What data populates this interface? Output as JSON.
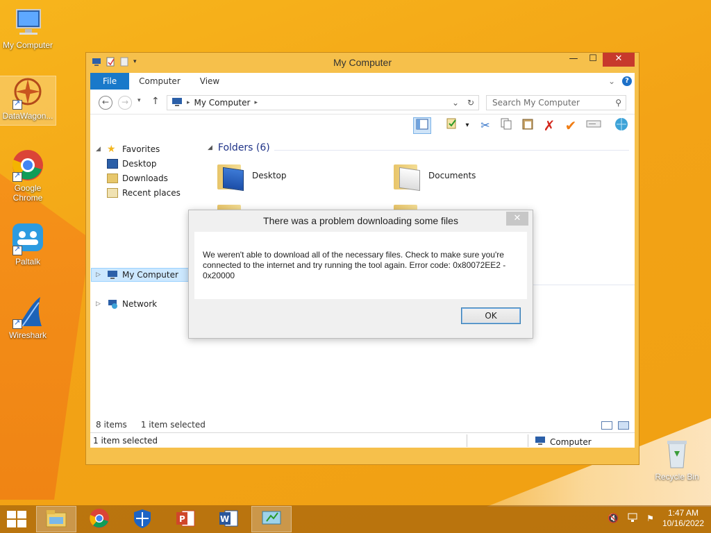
{
  "desktop": {
    "icons": [
      {
        "label": "My Computer"
      },
      {
        "label": "DataWagon..."
      },
      {
        "label": "Google Chrome"
      },
      {
        "label": "Paltalk"
      },
      {
        "label": "Wireshark"
      },
      {
        "label": "Recycle Bin"
      }
    ]
  },
  "explorer": {
    "title": "My Computer",
    "tabs": {
      "file": "File",
      "computer": "Computer",
      "view": "View"
    },
    "address": "My Computer",
    "search_placeholder": "Search My Computer",
    "nav": {
      "favorites": "Favorites",
      "desktop": "Desktop",
      "downloads": "Downloads",
      "recent": "Recent places",
      "my_computer": "My Computer",
      "network": "Network"
    },
    "group_header": "Folders (6)",
    "folders": [
      "Desktop",
      "Documents"
    ],
    "item_count": "8 items",
    "selected_count": "1 item selected",
    "statusbar_left": "1 item selected",
    "statusbar_right": "Computer"
  },
  "dialog": {
    "title": "There was a problem downloading some files",
    "message": "We weren't able to download all of the necessary files. Check to make sure you're connected to the internet and try running the tool again. Error code: 0x80072EE2 - 0x20000",
    "ok_label": "OK"
  },
  "taskbar": {
    "time": "1:47 AM",
    "date": "10/16/2022"
  },
  "colors": {
    "accent": "#1979ca",
    "desktop_bg": "#f3a316",
    "close_red": "#c7392c"
  }
}
